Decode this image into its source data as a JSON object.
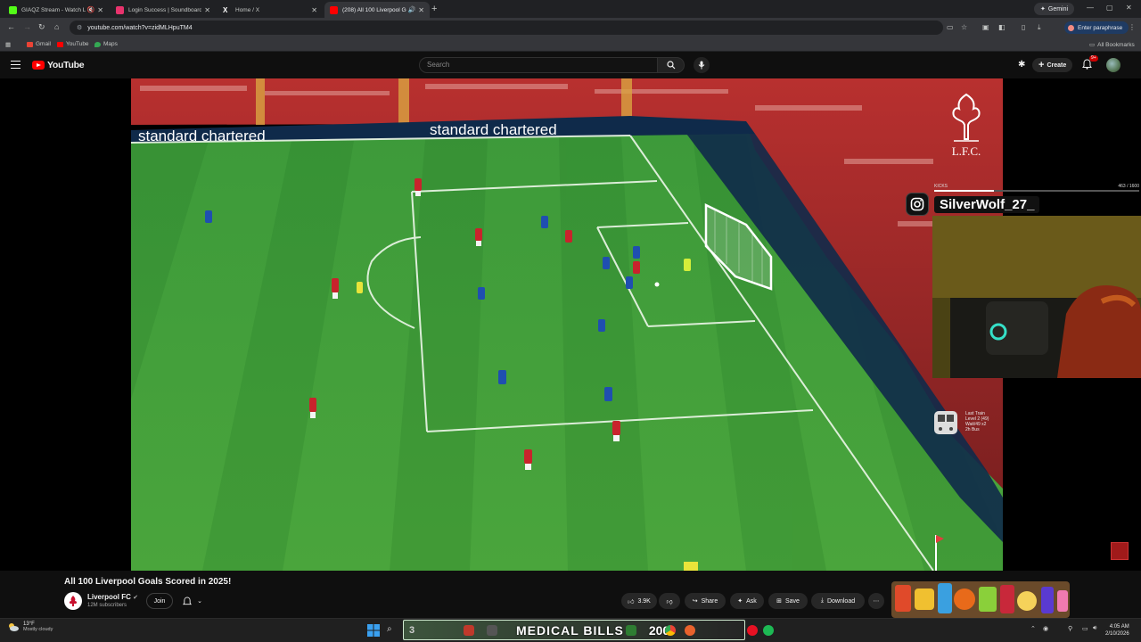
{
  "browser": {
    "tabs": [
      {
        "label": "GIAQZ Stream - Watch Live",
        "favicon_color": "#53fc18",
        "active": false
      },
      {
        "label": "Login Success | Soundboard Bot",
        "favicon_color": "#e8336d",
        "active": false
      },
      {
        "label": "Home / X",
        "favicon_color": "#ffffff",
        "active": false
      },
      {
        "label": "(208) All 100 Liverpool Goals",
        "favicon_color": "#ff0000",
        "active": true
      }
    ],
    "gemini_label": "Gemini",
    "url": "youtube.com/watch?v=zidMLHpuTM4",
    "paraphrase_label": "Enter paraphrase",
    "bookmarks": [
      {
        "label": "Gmail",
        "color": "#ea4335"
      },
      {
        "label": "YouTube",
        "color": "#ff0000"
      },
      {
        "label": "Maps",
        "color": "#34a853"
      }
    ],
    "all_bookmarks_label": "All Bookmarks"
  },
  "youtube": {
    "logo_text": "YouTube",
    "search_placeholder": "Search",
    "create_label": "Create",
    "notif_badge": "9+"
  },
  "overlay": {
    "instagram_handle": "SilverWolf_27_",
    "kicks_label": "KICKS",
    "kicks_value": "463 / 1600",
    "kicks_progress": 0.29,
    "train_lines": [
      "Last Train",
      "Level 2 (49)",
      "Wait/49 x2",
      "2h Bus"
    ]
  },
  "video": {
    "title": "All 100 Liverpool Goals Scored in 2025!",
    "board_text": "standard chartered",
    "crest_text": "L.F.C.",
    "channel": {
      "name": "Liverpool FC",
      "subscribers": "12M subscribers"
    },
    "join_label": "Join",
    "likes": "3.9K",
    "share_label": "Share",
    "ask_label": "Ask",
    "save_label": "Save",
    "download_label": "Download"
  },
  "taskbar": {
    "temperature": "13°F",
    "weather": "Mostly cloudy",
    "banner_number": "3",
    "banner_text": "MEDICAL BILLS",
    "banner_count": "200",
    "time": "4:05 AM",
    "date": "2/10/2026"
  }
}
